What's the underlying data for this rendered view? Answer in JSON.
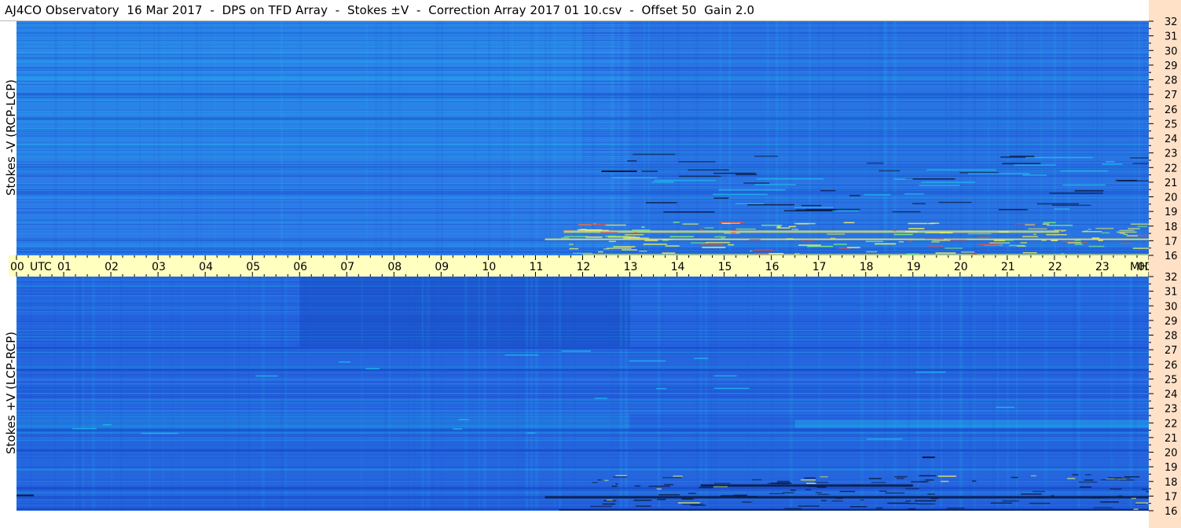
{
  "title": "AJ4CO Observatory  16 Mar 2017  -  DPS on TFD Array  -  Stokes ±V  -  Correction Array 2017 01 10.csv  -  Offset 50  Gain 2.0",
  "panels": {
    "top": {
      "ylabel": "Stokes -V (RCP-LCP)"
    },
    "bottom": {
      "ylabel": "Stokes +V (LCP-RCP)"
    }
  },
  "chart_data": {
    "type": "heatmap",
    "title": "AJ4CO Observatory  16 Mar 2017  -  DPS on TFD Array  -  Stokes ±V  -  Correction Array 2017 01 10.csv  -  Offset 50  Gain 2.0",
    "xlabel": "UTC",
    "ylabel": "MHz",
    "x_ticks": [
      "00",
      "01",
      "02",
      "03",
      "04",
      "05",
      "06",
      "07",
      "08",
      "09",
      "10",
      "11",
      "12",
      "13",
      "14",
      "15",
      "16",
      "17",
      "18",
      "19",
      "20",
      "21",
      "22",
      "23",
      "00"
    ],
    "x_unit_label": "UTC",
    "y_ticks": [
      "32",
      "31",
      "30",
      "29",
      "28",
      "27",
      "26",
      "25",
      "24",
      "23",
      "22",
      "21",
      "20",
      "19",
      "18",
      "17",
      "16"
    ],
    "y_unit_label": "MHz",
    "xlim_hours": [
      0,
      24
    ],
    "ylim_mhz": [
      16,
      32
    ],
    "series": [
      {
        "name": "Stokes -V (RCP-LCP)",
        "panel": "top"
      },
      {
        "name": "Stokes +V (LCP-RCP)",
        "panel": "bottom"
      }
    ],
    "colors": {
      "background_blue": "#2c7ce8",
      "deep_blue": "#1a4fcc",
      "light_blue": "#1ec8f0",
      "burst_yellow": "#f0f060",
      "burst_red": "#e05040",
      "dark_band": "#0a1a40",
      "axis_band_time": "#ffffc0",
      "axis_band_freq": "#ffe1c8"
    }
  }
}
